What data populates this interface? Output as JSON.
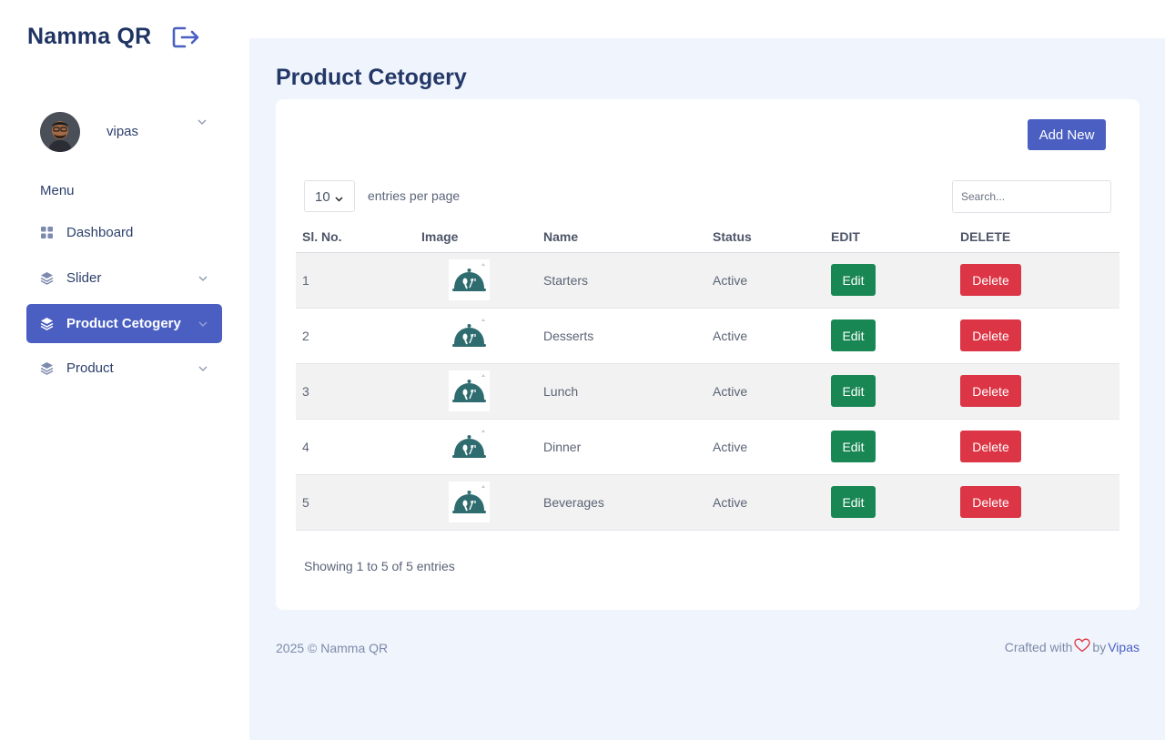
{
  "app": {
    "brand": "Namma QR"
  },
  "user": {
    "name": "vipas"
  },
  "menu": {
    "title": "Menu",
    "items": [
      {
        "label": "Dashboard",
        "icon": "grid-icon",
        "active": false,
        "has_chevron": false
      },
      {
        "label": "Slider",
        "icon": "layers-icon",
        "active": false,
        "has_chevron": true
      },
      {
        "label": "Product Cetogery",
        "icon": "layers-icon",
        "active": true,
        "has_chevron": true
      },
      {
        "label": "Product",
        "icon": "layers-icon",
        "active": false,
        "has_chevron": true
      }
    ]
  },
  "page": {
    "title": "Product Cetogery"
  },
  "toolbar": {
    "add_label": "Add New",
    "per_page_value": "10",
    "per_page_label": "entries per page",
    "search_placeholder": "Search..."
  },
  "table": {
    "headers": [
      "Sl. No.",
      "Image",
      "Name",
      "Status",
      "EDIT",
      "DELETE"
    ],
    "edit_label": "Edit",
    "delete_label": "Delete",
    "rows": [
      {
        "sl": "1",
        "name": "Starters",
        "status": "Active"
      },
      {
        "sl": "2",
        "name": "Desserts",
        "status": "Active"
      },
      {
        "sl": "3",
        "name": "Lunch",
        "status": "Active"
      },
      {
        "sl": "4",
        "name": "Dinner",
        "status": "Active"
      },
      {
        "sl": "5",
        "name": "Beverages",
        "status": "Active"
      }
    ]
  },
  "summary": {
    "showing": "Showing 1 to 5 of 5 entries"
  },
  "footer": {
    "copyright": "2025 © Namma QR",
    "crafted": "Crafted with",
    "by": "by",
    "author": "Vipas"
  },
  "colors": {
    "primary": "#4a5fc1",
    "success": "#198754",
    "danger": "#dc3545",
    "main_bg": "#f0f5fd",
    "heading": "#243868"
  }
}
